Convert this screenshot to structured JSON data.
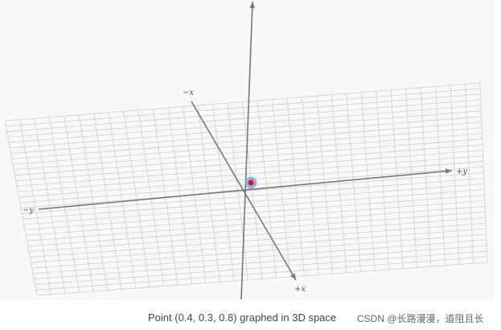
{
  "figure": {
    "axis_labels": {
      "neg_x": "−x",
      "pos_x": "+x",
      "neg_y": "−y",
      "pos_y": "+y"
    },
    "point": {
      "x": 0.4,
      "y": 0.3,
      "z": 0.8
    },
    "colors": {
      "background": "#f8f8f8",
      "grid": "#cfcfcf",
      "axis": "#777777",
      "point": "#e01b1b",
      "point_glow": "#6fa6e6"
    }
  },
  "caption": "Point (0.4, 0.3, 0.8) graphed in 3D space",
  "watermark": "CSDN @长路漫漫，道阻且长"
}
